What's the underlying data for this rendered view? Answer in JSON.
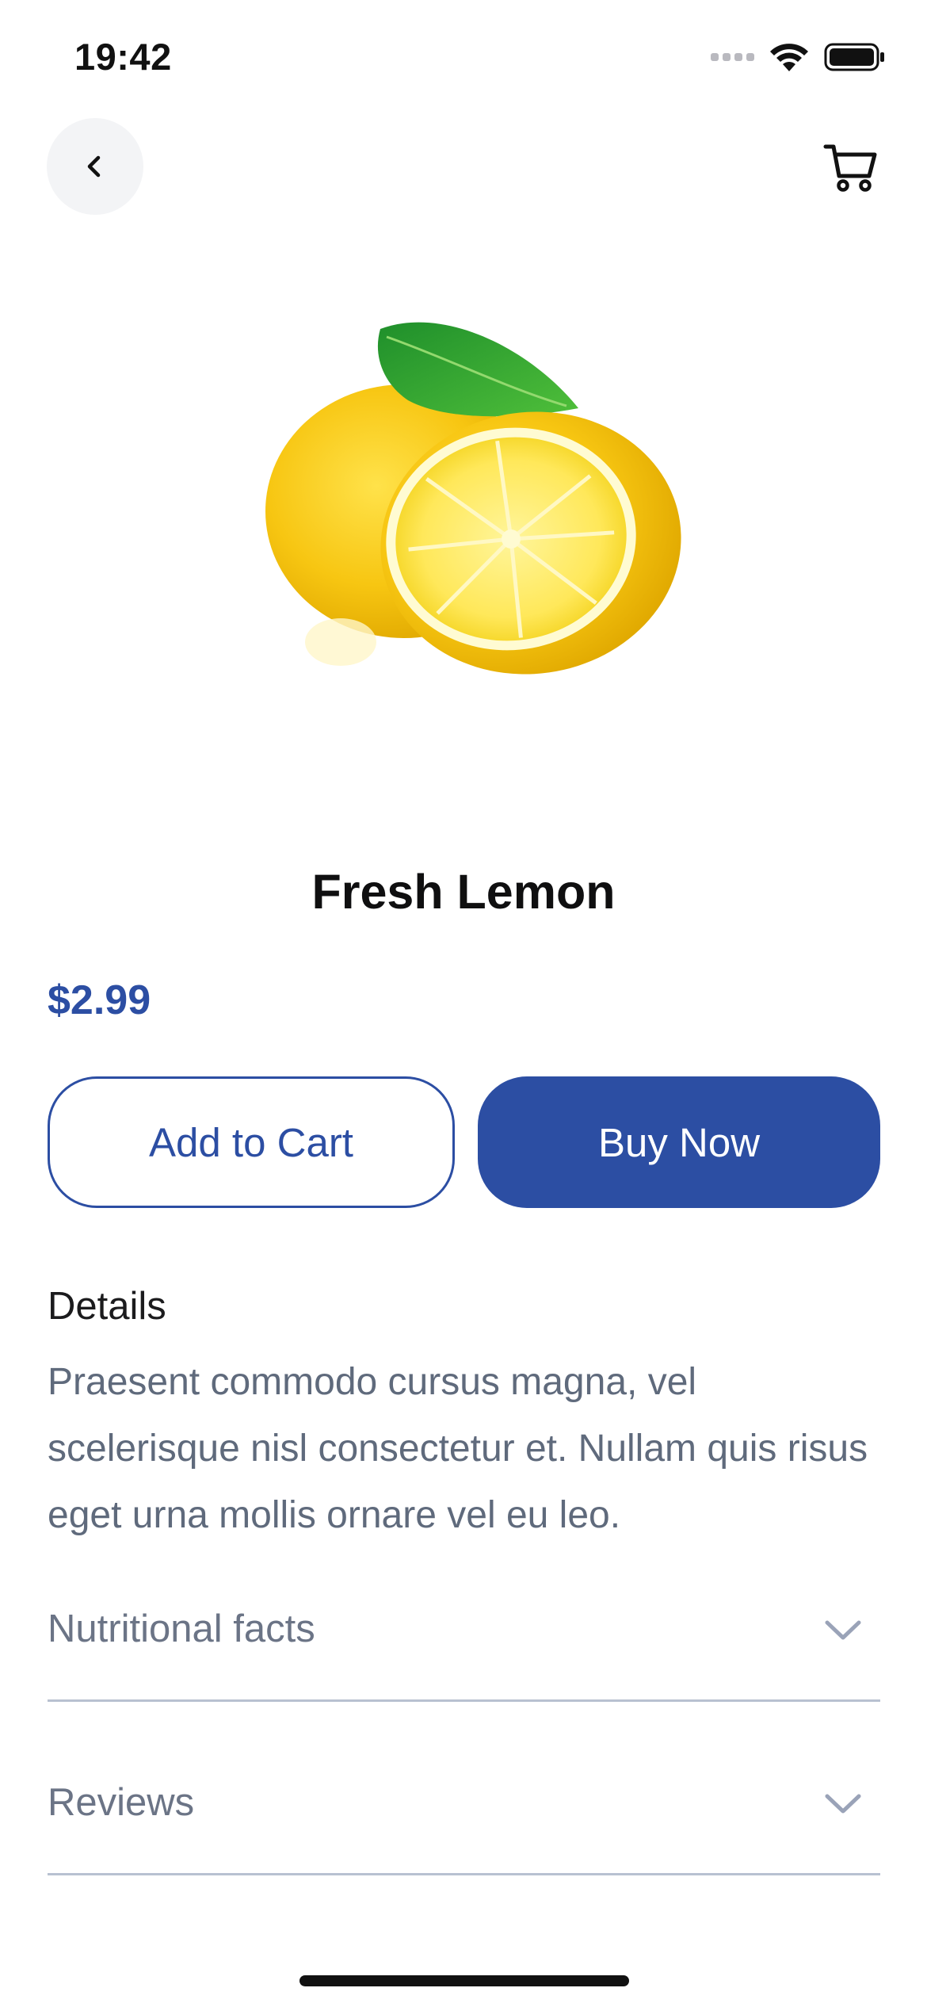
{
  "status_bar": {
    "time": "19:42"
  },
  "header": {
    "back_icon": "chevron-left-icon",
    "cart_icon": "shopping-cart-icon"
  },
  "product": {
    "name": "Fresh Lemon",
    "price": "$2.99",
    "image": "lemon-image"
  },
  "actions": {
    "add_to_cart": "Add to Cart",
    "buy_now": "Buy Now"
  },
  "details": {
    "heading": "Details",
    "body": "Praesent commodo cursus magna, vel scelerisque nisl consectetur et. Nullam quis risus eget urna mollis ornare vel eu leo."
  },
  "sections": [
    {
      "label": "Nutritional facts",
      "expanded": false
    },
    {
      "label": "Reviews",
      "expanded": false
    }
  ],
  "colors": {
    "accent": "#2c4ea3",
    "muted_text": "#6b7486",
    "divider": "#b8c1d1"
  }
}
